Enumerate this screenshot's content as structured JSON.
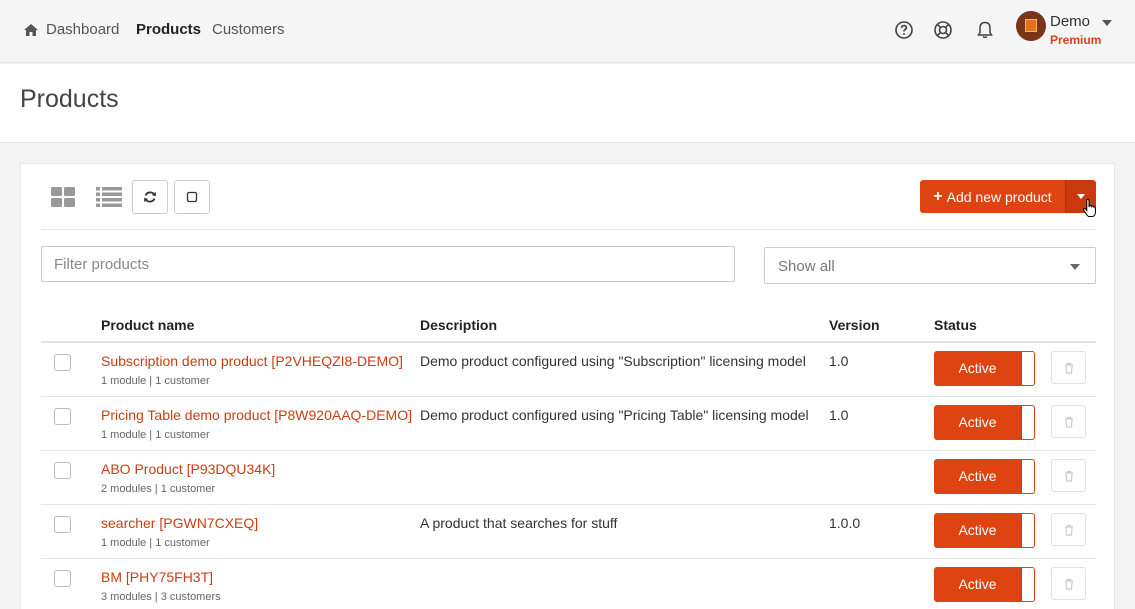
{
  "nav": {
    "home_icon": "home-icon",
    "links": [
      {
        "label": "Dashboard",
        "active": false
      },
      {
        "label": "Products",
        "active": true
      },
      {
        "label": "Customers",
        "active": false
      }
    ],
    "icons": [
      "help-icon",
      "support-icon",
      "bell-icon"
    ],
    "user": {
      "name": "Demo",
      "plan": "Premium"
    }
  },
  "page": {
    "title": "Products"
  },
  "toolbar": {
    "add_label": "Add new product",
    "accent_color": "#dd4412"
  },
  "filter": {
    "placeholder": "Filter products",
    "value": "",
    "select_value": "Show all"
  },
  "table": {
    "headers": {
      "name": "Product name",
      "description": "Description",
      "version": "Version",
      "status": "Status"
    },
    "rows": [
      {
        "name": "Subscription demo product [P2VHEQZI8-DEMO]",
        "meta": "1 module | 1 customer",
        "description": "Demo product configured using \"Subscription\" licensing model",
        "version": "1.0",
        "status": "Active"
      },
      {
        "name": "Pricing Table demo product [P8W920AAQ-DEMO]",
        "meta": "1 module | 1 customer",
        "description": "Demo product configured using \"Pricing Table\" licensing model",
        "version": "1.0",
        "status": "Active"
      },
      {
        "name": "ABO Product [P93DQU34K]",
        "meta": "2 modules | 1 customer",
        "description": "",
        "version": "",
        "status": "Active"
      },
      {
        "name": "searcher [PGWN7CXEQ]",
        "meta": "1 module | 1 customer",
        "description": "A product that searches for stuff",
        "version": "1.0.0",
        "status": "Active"
      },
      {
        "name": "BM [PHY75FH3T]",
        "meta": "3 modules | 3 customers",
        "description": "",
        "version": "",
        "status": "Active"
      }
    ]
  }
}
